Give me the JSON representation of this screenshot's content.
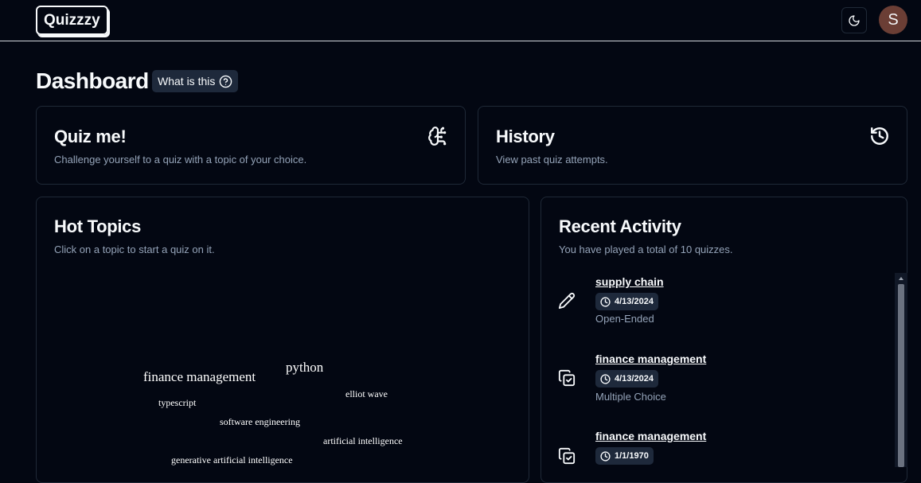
{
  "header": {
    "logo": "Quizzzy",
    "avatar_initial": "S"
  },
  "page": {
    "title": "Dashboard",
    "what_is_this": "What is this"
  },
  "quiz_card": {
    "title": "Quiz me!",
    "subtitle": "Challenge yourself to a quiz with a topic of your choice.",
    "icon": "brain-circuit-icon"
  },
  "history_card": {
    "title": "History",
    "subtitle": "View past quiz attempts.",
    "icon": "history-icon"
  },
  "hot_topics": {
    "title": "Hot Topics",
    "subtitle": "Click on a topic to start a quiz on it.",
    "words": [
      "finance management",
      "python",
      "elliot wave",
      "typescript",
      "software engineering",
      "artificial intelligence",
      "generative artificial intelligence"
    ]
  },
  "recent_activity": {
    "title": "Recent Activity",
    "subtitle": "You have played a total of 10 quizzes.",
    "items": [
      {
        "topic": "supply chain",
        "date": "4/13/2024",
        "type": "Open-Ended",
        "icon": "pencil-icon"
      },
      {
        "topic": "finance management",
        "date": "4/13/2024",
        "type": "Multiple Choice",
        "icon": "copy-check-icon"
      },
      {
        "topic": "finance management",
        "date": "1/1/1970",
        "type": "",
        "icon": "copy-check-icon"
      }
    ]
  }
}
